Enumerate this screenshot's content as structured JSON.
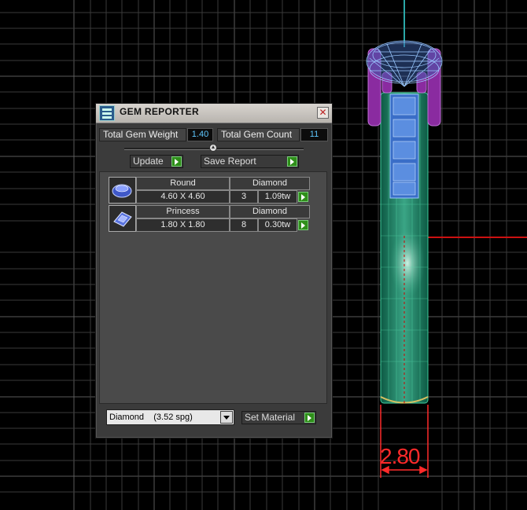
{
  "panel": {
    "title": "GEM REPORTER",
    "close_glyph": "✕",
    "total_weight_label": "Total Gem Weight",
    "total_weight_value": "1.40",
    "total_count_label": "Total Gem Count",
    "total_count_value": "11",
    "slider_value": 0.5,
    "update_label": "Update",
    "save_report_label": "Save Report",
    "gems": [
      {
        "icon": "round-gem-icon",
        "shape": "Round",
        "material": "Diamond",
        "size": "4.60 X 4.60",
        "count": "3",
        "weight": "1.09tw"
      },
      {
        "icon": "princess-gem-icon",
        "shape": "Princess",
        "material": "Diamond",
        "size": "1.80 X 1.80",
        "count": "8",
        "weight": "0.30tw"
      }
    ],
    "material_select_value": "Diamond    (3.52 spg)",
    "set_material_label": "Set Material"
  },
  "viewport": {
    "dimension_label": "2.80",
    "colors": {
      "background": "#000000",
      "grid": "#5a5a5a",
      "band": "#1f8a68",
      "prongs": "#8a2ba0",
      "wire": "#7fb4ff",
      "dimension": "#ff2a2a",
      "axis_x": "#cc1111",
      "axis_y": "#2aa7a7"
    }
  }
}
